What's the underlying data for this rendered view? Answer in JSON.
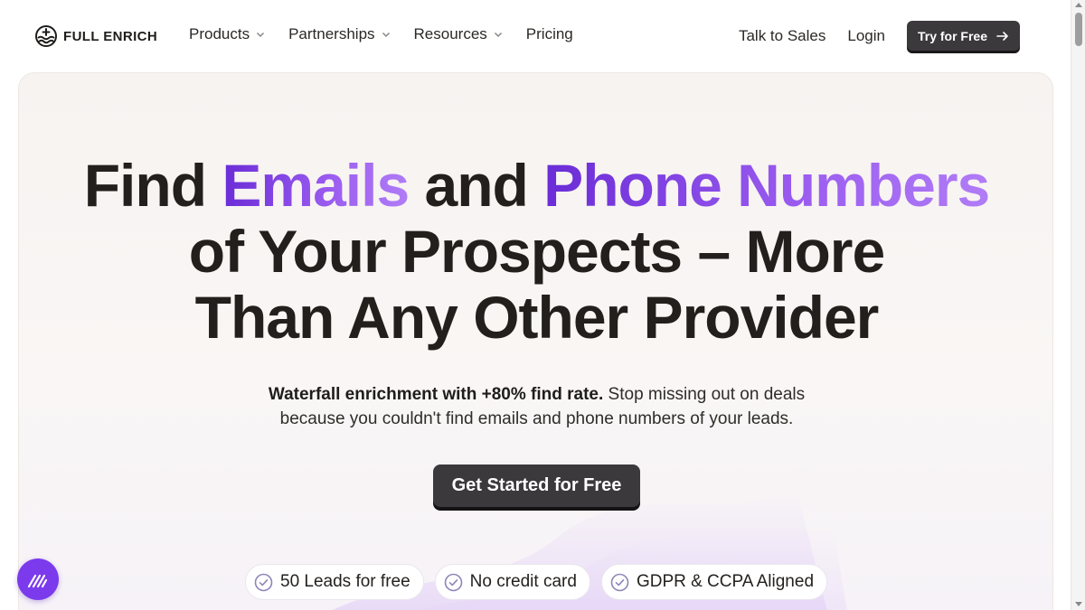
{
  "header": {
    "logo_text": "FULL ENRICH",
    "nav": [
      {
        "label": "Products",
        "has_dropdown": true
      },
      {
        "label": "Partnerships",
        "has_dropdown": true
      },
      {
        "label": "Resources",
        "has_dropdown": true
      },
      {
        "label": "Pricing",
        "has_dropdown": false
      }
    ],
    "talk_to_sales": "Talk to Sales",
    "login": "Login",
    "try_for_free": "Try for Free"
  },
  "hero": {
    "headline": {
      "part1": "Find ",
      "emails": "Emails",
      "part2": " and ",
      "phone_numbers": "Phone Numbers",
      "line2": "of Your Prospects – More",
      "line3": "Than Any Other Provider"
    },
    "subtext_bold": "Waterfall enrichment with +80% find rate.",
    "subtext_rest1": " Stop missing out on deals",
    "subtext_rest2": "because you couldn't find emails and phone numbers of your leads.",
    "cta": "Get Started for Free",
    "badges": [
      {
        "label": "50 Leads for free",
        "icon": "check-circle-icon"
      },
      {
        "label": "No credit card",
        "icon": "check-circle-icon"
      },
      {
        "label": "GDPR & CCPA Aligned",
        "icon": "check-circle-icon"
      }
    ]
  },
  "colors": {
    "accent_purple": "#7c3aed",
    "dark_button": "#3b393c",
    "text_dark": "#231f1c"
  },
  "icons": [
    "logo-icon",
    "chevron-down-icon",
    "arrow-right-icon",
    "check-circle-icon",
    "chat-widget-icon"
  ]
}
